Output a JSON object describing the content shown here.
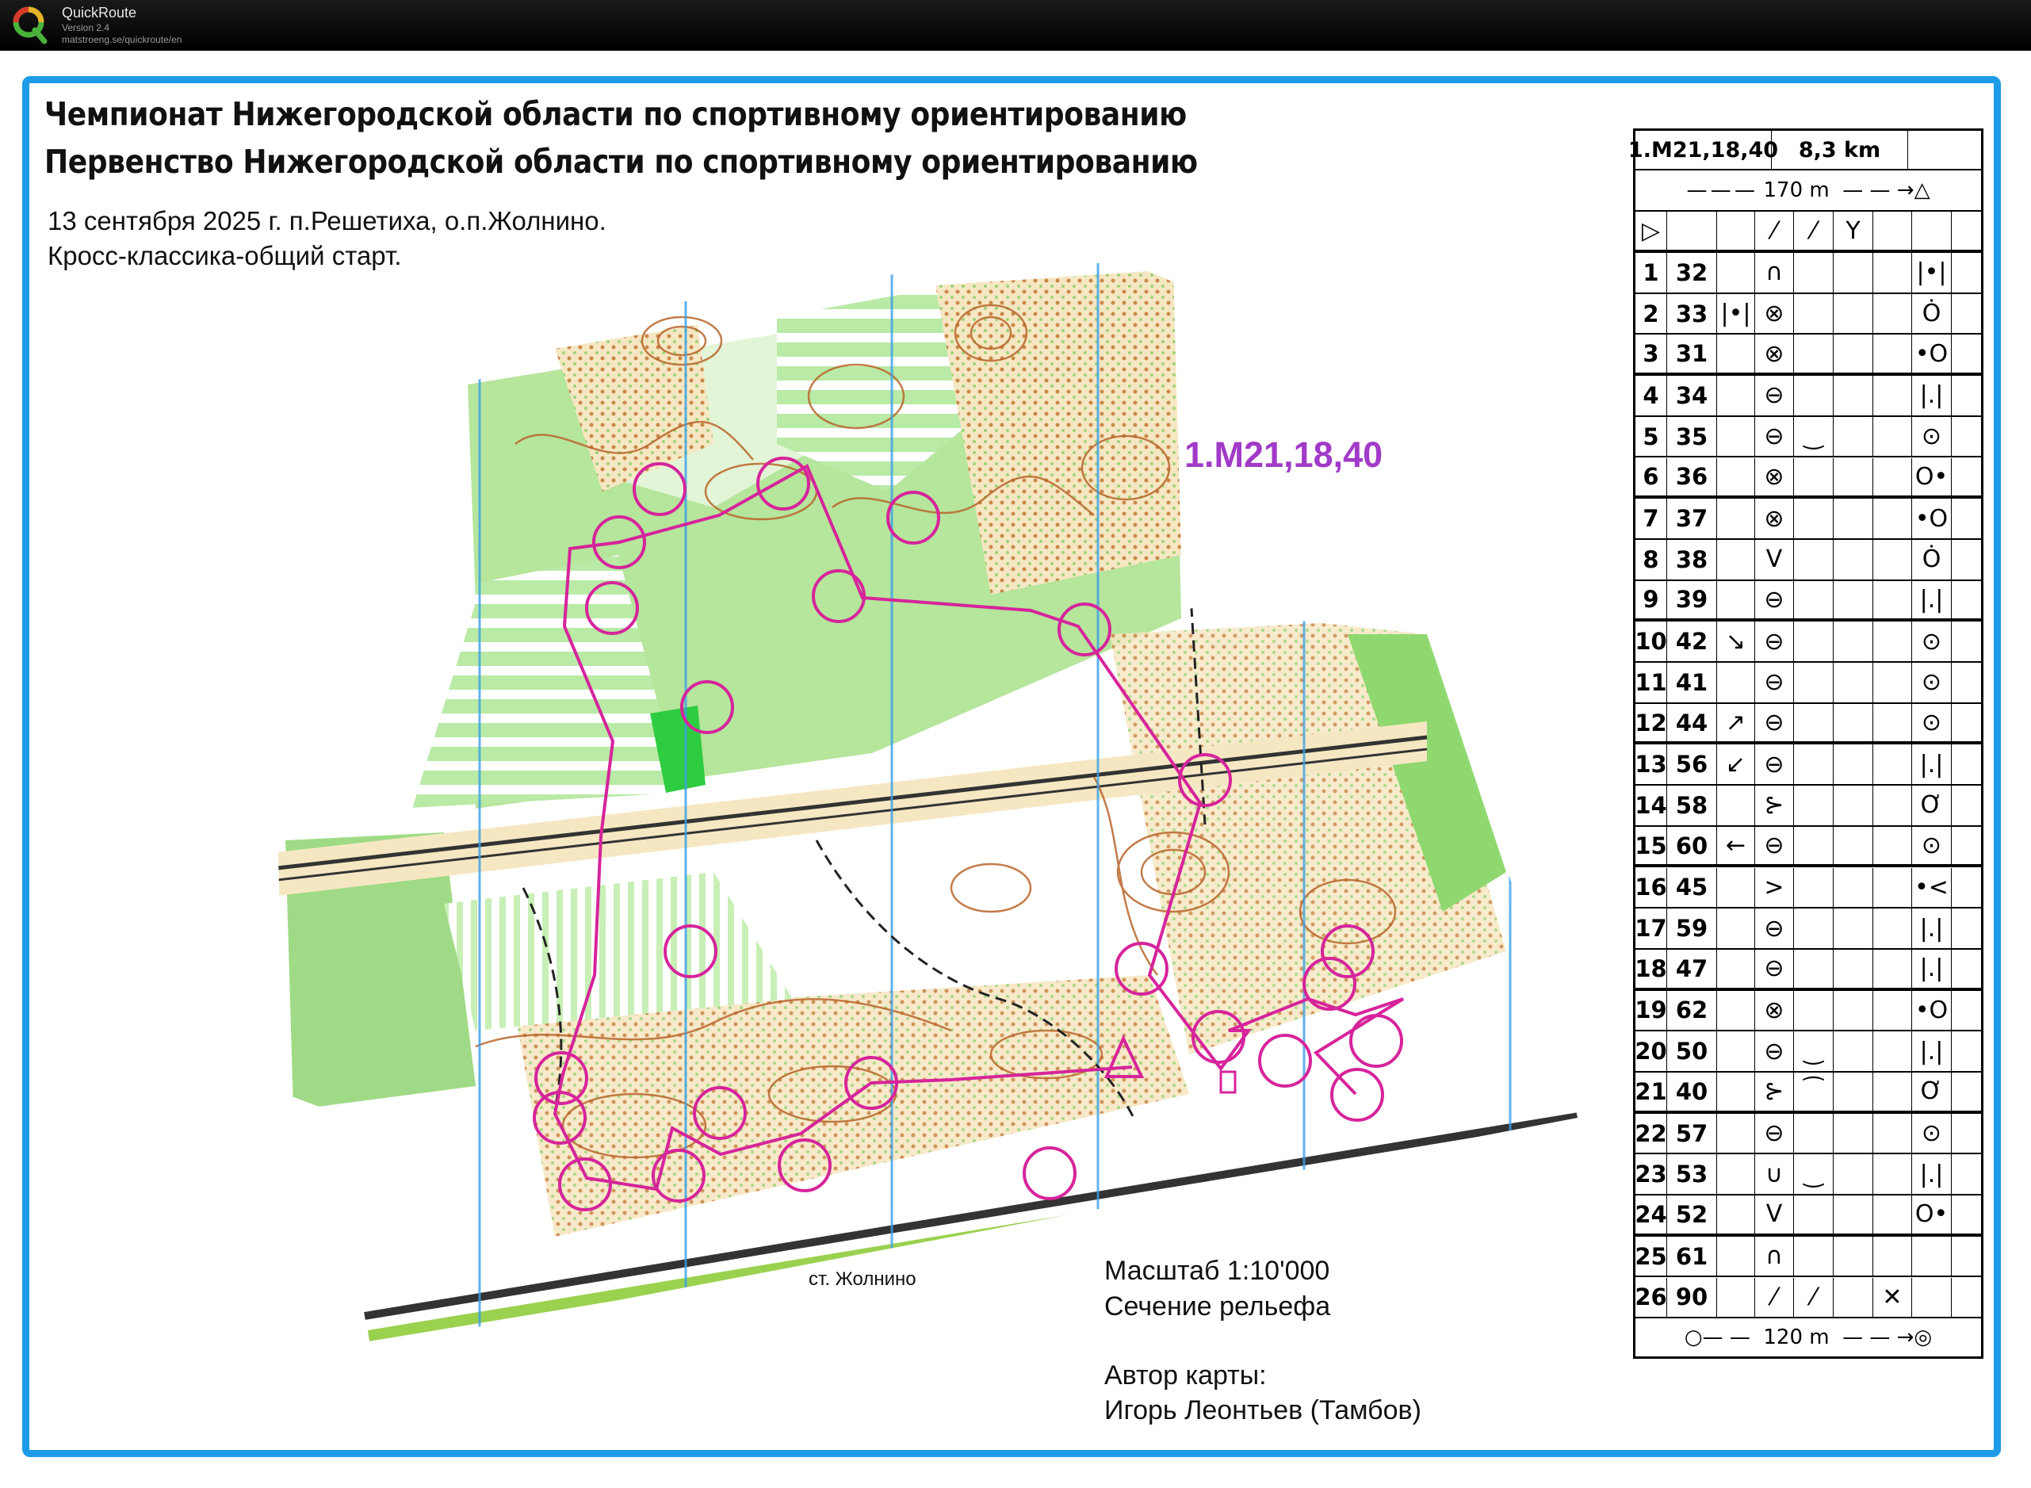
{
  "app": {
    "name": "QuickRoute",
    "version": "Version 2.4",
    "url": "matstroeng.se/quickroute/en"
  },
  "map": {
    "title_line1": "Чемпионат Нижегородской области по спортивному ориентированию",
    "title_line2": "Первенство Нижегородской области по спортивному ориентированию",
    "subtitle_line1": "13 сентября 2025 г. п.Решетиха, о.п.Жолнино.",
    "subtitle_line2": "Кросс-классика-общий старт.",
    "course_label": "1.М21,18,40",
    "scale": "Масштаб 1:10'000",
    "contour": "Сечение рельефа",
    "author_label": "Автор карты:",
    "author_name": "Игорь Леонтьев (Тамбов)",
    "station": "ст. Жолнино",
    "colors": {
      "frame": "#1e9be6",
      "course": "#d6249b",
      "forest": "#8fd86f",
      "open": "#f4f0d8",
      "contour": "#b8652a",
      "course_label": "#a13ac8"
    }
  },
  "description_sheet": {
    "course": "1.М21,18,40",
    "length": "8,3 km",
    "start_marking": "170 m",
    "finish_marking": "120 m",
    "controls": [
      {
        "n": "1",
        "code": "32",
        "c": "",
        "d": "∩",
        "e": "",
        "g": "",
        "h": "|•|"
      },
      {
        "n": "2",
        "code": "33",
        "c": "|•|",
        "d": "⊗",
        "e": "",
        "g": "",
        "h": "Ȯ"
      },
      {
        "n": "3",
        "code": "31",
        "c": "",
        "d": "⊗",
        "e": "",
        "g": "",
        "h": "•O"
      },
      {
        "n": "4",
        "code": "34",
        "c": "",
        "d": "⊖",
        "e": "",
        "g": "",
        "h": "|.|"
      },
      {
        "n": "5",
        "code": "35",
        "c": "",
        "d": "⊖",
        "e": "‿",
        "g": "",
        "h": "⊙"
      },
      {
        "n": "6",
        "code": "36",
        "c": "",
        "d": "⊗",
        "e": "",
        "g": "",
        "h": "O•"
      },
      {
        "n": "7",
        "code": "37",
        "c": "",
        "d": "⊗",
        "e": "",
        "g": "",
        "h": "•O"
      },
      {
        "n": "8",
        "code": "38",
        "c": "",
        "d": "V",
        "e": "",
        "g": "",
        "h": "Ȯ"
      },
      {
        "n": "9",
        "code": "39",
        "c": "",
        "d": "⊖",
        "e": "",
        "g": "",
        "h": "|.|"
      },
      {
        "n": "10",
        "code": "42",
        "c": "↘",
        "d": "⊖",
        "e": "",
        "g": "",
        "h": "⊙"
      },
      {
        "n": "11",
        "code": "41",
        "c": "",
        "d": "⊖",
        "e": "",
        "g": "",
        "h": "⊙"
      },
      {
        "n": "12",
        "code": "44",
        "c": "↗",
        "d": "⊖",
        "e": "",
        "g": "",
        "h": "⊙"
      },
      {
        "n": "13",
        "code": "56",
        "c": "↙",
        "d": "⊖",
        "e": "",
        "g": "",
        "h": "|.|"
      },
      {
        "n": "14",
        "code": "58",
        "c": "",
        "d": "⊱",
        "e": "",
        "g": "",
        "h": "Ơ"
      },
      {
        "n": "15",
        "code": "60",
        "c": "←",
        "d": "⊖",
        "e": "",
        "g": "",
        "h": "⊙"
      },
      {
        "n": "16",
        "code": "45",
        "c": "",
        "d": ">",
        "e": "",
        "g": "",
        "h": "•<"
      },
      {
        "n": "17",
        "code": "59",
        "c": "",
        "d": "⊖",
        "e": "",
        "g": "",
        "h": "|.|"
      },
      {
        "n": "18",
        "code": "47",
        "c": "",
        "d": "⊖",
        "e": "",
        "g": "",
        "h": "|.|"
      },
      {
        "n": "19",
        "code": "62",
        "c": "",
        "d": "⊗",
        "e": "",
        "g": "",
        "h": "•O"
      },
      {
        "n": "20",
        "code": "50",
        "c": "",
        "d": "⊖",
        "e": "‿",
        "g": "",
        "h": "|.|"
      },
      {
        "n": "21",
        "code": "40",
        "c": "",
        "d": "⊱",
        "e": "⁀",
        "g": "",
        "h": "Ơ"
      },
      {
        "n": "22",
        "code": "57",
        "c": "",
        "d": "⊖",
        "e": "",
        "g": "",
        "h": "⊙"
      },
      {
        "n": "23",
        "code": "53",
        "c": "",
        "d": "∪",
        "e": "‿",
        "g": "",
        "h": "|.|"
      },
      {
        "n": "24",
        "code": "52",
        "c": "",
        "d": "V",
        "e": "",
        "g": "",
        "h": "O•"
      },
      {
        "n": "25",
        "code": "61",
        "c": "",
        "d": "∩",
        "e": "",
        "g": "",
        "h": ""
      },
      {
        "n": "26",
        "code": "90",
        "c": "",
        "d": "⁄",
        "e": "⁄",
        "g": "✕",
        "h": ""
      }
    ]
  }
}
